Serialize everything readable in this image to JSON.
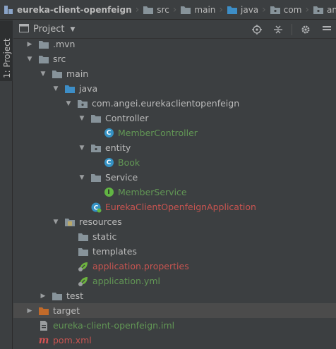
{
  "breadcrumb": [
    "eureka-client-openfeign",
    "src",
    "main",
    "java",
    "com",
    "angei"
  ],
  "side_tab": {
    "label": "1: Project"
  },
  "panel": {
    "title": "Project"
  },
  "tree": {
    "mvn": ".mvn",
    "src": "src",
    "main": "main",
    "java": "java",
    "package": "com.angei.eurekaclientopenfeign",
    "controller": "Controller",
    "member_controller": "MemberController",
    "entity": "entity",
    "book": "Book",
    "service": "Service",
    "member_service": "MemberService",
    "application": "EurekaClientOpenfeignApplication",
    "resources": "resources",
    "static": "static",
    "templates": "templates",
    "app_properties": "application.properties",
    "app_yml": "application.yml",
    "test": "test",
    "target": "target",
    "iml": "eureka-client-openfeign.iml",
    "pom": "pom.xml"
  },
  "colors": {
    "background": "#3c3f41",
    "text": "#bbbbbb",
    "green_file": "#629755",
    "red_file": "#c75450",
    "folder": "#87939a",
    "source_folder": "#3d8ec7",
    "target_folder": "#c16a2a",
    "class_icon": "#3592c4"
  }
}
